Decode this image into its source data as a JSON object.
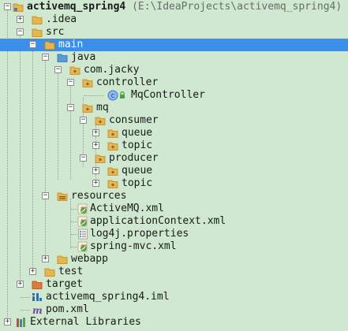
{
  "tree": [
    {
      "label": "activemq_spring4",
      "path": "(E:\\IdeaProjects\\activemq_spring4)",
      "icon": "module-folder-icon",
      "toggle": "−",
      "bold": true
    },
    {
      "label": ".idea",
      "icon": "folder-icon",
      "toggle": "+"
    },
    {
      "label": "src",
      "icon": "folder-icon",
      "toggle": "−"
    },
    {
      "label": "main",
      "icon": "folder-icon",
      "toggle": "−",
      "selected": true
    },
    {
      "label": "java",
      "icon": "source-folder-icon",
      "toggle": "−"
    },
    {
      "label": "com.jacky",
      "icon": "package-icon",
      "toggle": "−"
    },
    {
      "label": "controller",
      "icon": "package-icon",
      "toggle": "−"
    },
    {
      "label": "MqController",
      "icon": "class-icon"
    },
    {
      "label": "mq",
      "icon": "package-icon",
      "toggle": "−"
    },
    {
      "label": "consumer",
      "icon": "package-icon",
      "toggle": "−"
    },
    {
      "label": "queue",
      "icon": "package-icon",
      "toggle": "+"
    },
    {
      "label": "topic",
      "icon": "package-icon",
      "toggle": "+"
    },
    {
      "label": "producer",
      "icon": "package-icon",
      "toggle": "−"
    },
    {
      "label": "queue",
      "icon": "package-icon",
      "toggle": "+"
    },
    {
      "label": "topic",
      "icon": "package-icon",
      "toggle": "+"
    },
    {
      "label": "resources",
      "icon": "resources-folder-icon",
      "toggle": "−"
    },
    {
      "label": "ActiveMQ.xml",
      "icon": "spring-xml-icon"
    },
    {
      "label": "applicationContext.xml",
      "icon": "spring-xml-icon"
    },
    {
      "label": "log4j.properties",
      "icon": "properties-file-icon"
    },
    {
      "label": "spring-mvc.xml",
      "icon": "spring-xml-icon"
    },
    {
      "label": "webapp",
      "icon": "folder-icon",
      "toggle": "+"
    },
    {
      "label": "test",
      "icon": "folder-icon",
      "toggle": "+"
    },
    {
      "label": "target",
      "icon": "excluded-folder-icon",
      "toggle": "+"
    },
    {
      "label": "activemq_spring4.iml",
      "icon": "iml-file-icon"
    },
    {
      "label": "pom.xml",
      "icon": "maven-file-icon"
    },
    {
      "label": "External Libraries",
      "icon": "libraries-icon",
      "toggle": "+"
    }
  ],
  "colors": {
    "background": "#cfe8cf",
    "selection": "#3d8ee8",
    "folder": "#e8b64c",
    "sourceFolder": "#5b9bd5",
    "resourcesFolder": "#c9a24a",
    "excludedFolder": "#e07a3a",
    "classIcon": "#3a7bd5"
  }
}
